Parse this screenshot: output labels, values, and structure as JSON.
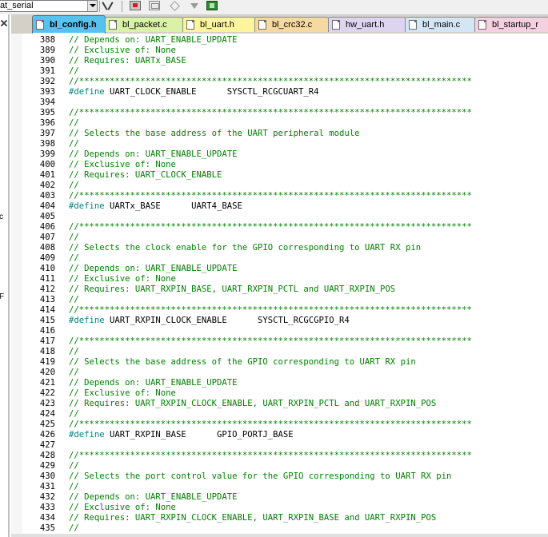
{
  "toolbar": {
    "target_combo": "at_serial",
    "icons": [
      "tools-icon",
      "load-icon",
      "window-icon",
      "diamond-icon",
      "arrow-down-icon",
      "chip-icon"
    ]
  },
  "left_panel": {
    "stub_chars": [
      "c",
      "F"
    ]
  },
  "tabs": [
    {
      "label": "bl_config.h",
      "active": true,
      "color": "#56c3ef"
    },
    {
      "label": "bl_packet.c",
      "active": false,
      "color": "#d9f2a8"
    },
    {
      "label": "bl_uart.h",
      "active": false,
      "color": "#fdf59e"
    },
    {
      "label": "bl_crc32.c",
      "active": false,
      "color": "#f5d9a0"
    },
    {
      "label": "hw_uart.h",
      "active": false,
      "color": "#ddd4f0"
    },
    {
      "label": "bl_main.c",
      "active": false,
      "color": "#d4e6f5"
    },
    {
      "label": "bl_startup_r",
      "active": false,
      "color": "#f5d0e0"
    }
  ],
  "editor": {
    "lines": [
      {
        "n": "388",
        "kind": "comment",
        "text": "// Depends on: UART_ENABLE_UPDATE"
      },
      {
        "n": "389",
        "kind": "comment",
        "text": "// Exclusive of: None"
      },
      {
        "n": "390",
        "kind": "comment",
        "text": "// Requires: UARTx_BASE"
      },
      {
        "n": "391",
        "kind": "comment",
        "text": "//"
      },
      {
        "n": "392",
        "kind": "comment",
        "text": "//*****************************************************************************"
      },
      {
        "n": "393",
        "kind": "define",
        "kw": "#define",
        "text": " UART_CLOCK_ENABLE      SYSCTL_RCGCUART_R4"
      },
      {
        "n": "394",
        "kind": "blank",
        "text": ""
      },
      {
        "n": "395",
        "kind": "comment",
        "text": "//*****************************************************************************"
      },
      {
        "n": "396",
        "kind": "comment",
        "text": "//"
      },
      {
        "n": "397",
        "kind": "comment",
        "text": "// Selects the base address of the UART peripheral module"
      },
      {
        "n": "398",
        "kind": "comment",
        "text": "//"
      },
      {
        "n": "399",
        "kind": "comment",
        "text": "// Depends on: UART_ENABLE_UPDATE"
      },
      {
        "n": "400",
        "kind": "comment",
        "text": "// Exclusive of: None"
      },
      {
        "n": "401",
        "kind": "comment",
        "text": "// Requires: UART_CLOCK_ENABLE"
      },
      {
        "n": "402",
        "kind": "comment",
        "text": "//"
      },
      {
        "n": "403",
        "kind": "comment",
        "text": "//*****************************************************************************"
      },
      {
        "n": "404",
        "kind": "define",
        "kw": "#define",
        "text": " UARTx_BASE      UART4_BASE"
      },
      {
        "n": "405",
        "kind": "blank",
        "text": ""
      },
      {
        "n": "406",
        "kind": "comment",
        "text": "//*****************************************************************************"
      },
      {
        "n": "407",
        "kind": "comment",
        "text": "//"
      },
      {
        "n": "408",
        "kind": "comment",
        "text": "// Selects the clock enable for the GPIO corresponding to UART RX pin"
      },
      {
        "n": "409",
        "kind": "comment",
        "text": "//"
      },
      {
        "n": "410",
        "kind": "comment",
        "text": "// Depends on: UART_ENABLE_UPDATE"
      },
      {
        "n": "411",
        "kind": "comment",
        "text": "// Exclusive of: None"
      },
      {
        "n": "412",
        "kind": "comment",
        "text": "// Requires: UART_RXPIN_BASE, UART_RXPIN_PCTL and UART_RXPIN_POS"
      },
      {
        "n": "413",
        "kind": "comment",
        "text": "//"
      },
      {
        "n": "414",
        "kind": "comment",
        "text": "//*****************************************************************************"
      },
      {
        "n": "415",
        "kind": "define",
        "kw": "#define",
        "text": " UART_RXPIN_CLOCK_ENABLE      SYSCTL_RCGCGPIO_R4"
      },
      {
        "n": "416",
        "kind": "blank",
        "text": ""
      },
      {
        "n": "417",
        "kind": "comment",
        "text": "//*****************************************************************************"
      },
      {
        "n": "418",
        "kind": "comment",
        "text": "//"
      },
      {
        "n": "419",
        "kind": "comment",
        "text": "// Selects the base address of the GPIO corresponding to UART RX pin"
      },
      {
        "n": "420",
        "kind": "comment",
        "text": "//"
      },
      {
        "n": "421",
        "kind": "comment",
        "text": "// Depends on: UART_ENABLE_UPDATE"
      },
      {
        "n": "422",
        "kind": "comment",
        "text": "// Exclusive of: None"
      },
      {
        "n": "423",
        "kind": "comment",
        "text": "// Requires: UART_RXPIN_CLOCK_ENABLE, UART_RXPIN_PCTL and UART_RXPIN_POS"
      },
      {
        "n": "424",
        "kind": "comment",
        "text": "//"
      },
      {
        "n": "425",
        "kind": "comment",
        "text": "//*****************************************************************************"
      },
      {
        "n": "426",
        "kind": "define",
        "kw": "#define",
        "text": " UART_RXPIN_BASE      GPIO_PORTJ_BASE"
      },
      {
        "n": "427",
        "kind": "blank",
        "text": ""
      },
      {
        "n": "428",
        "kind": "comment",
        "text": "//*****************************************************************************"
      },
      {
        "n": "429",
        "kind": "comment",
        "text": "//"
      },
      {
        "n": "430",
        "kind": "comment",
        "text": "// Selects the port control value for the GPIO corresponding to UART RX pin"
      },
      {
        "n": "431",
        "kind": "comment",
        "text": "//"
      },
      {
        "n": "432",
        "kind": "comment",
        "text": "// Depends on: UART_ENABLE_UPDATE"
      },
      {
        "n": "433",
        "kind": "comment",
        "text": "// Exclusive of: None"
      },
      {
        "n": "434",
        "kind": "comment",
        "text": "// Requires: UART_RXPIN_CLOCK_ENABLE, UART_RXPIN_BASE and UART_RXPIN_POS"
      },
      {
        "n": "435",
        "kind": "comment",
        "text": "//"
      }
    ]
  },
  "colors": {
    "comment": "#008000",
    "keyword": "#008080",
    "code": "#000000",
    "line_number": "#000000"
  }
}
